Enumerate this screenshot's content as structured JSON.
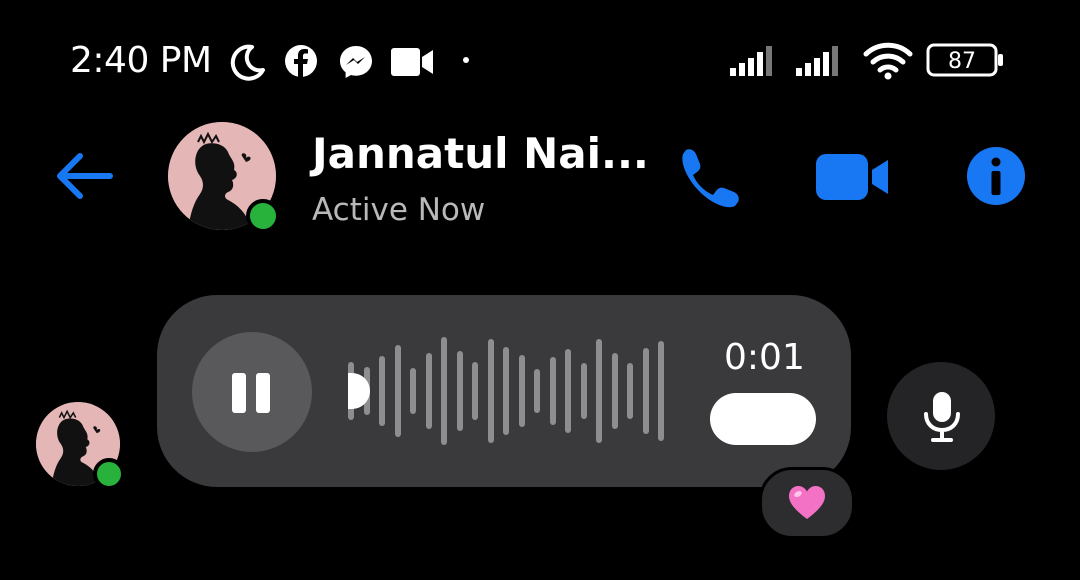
{
  "status_bar": {
    "time": "2:40 PM",
    "icons": [
      "moon-icon",
      "facebook-icon",
      "messenger-icon",
      "video-camera-icon",
      "dot-icon"
    ],
    "signal_icons": [
      "signal-1-icon",
      "signal-2-icon",
      "wifi-icon"
    ],
    "battery_level": "87"
  },
  "header": {
    "back_icon": "arrow-left-icon",
    "contact_name": "Jannatul Nai...",
    "contact_status": "Active Now",
    "actions": [
      "phone-icon",
      "video-icon",
      "info-icon"
    ]
  },
  "message": {
    "type": "voice",
    "duration": "0:01",
    "reaction": "❤️",
    "playing": true
  },
  "composer": {
    "mic_icon": "microphone-icon"
  },
  "colors": {
    "accent": "#1877f2",
    "online": "#28b23b",
    "bubble": "#3a3a3c",
    "background": "#000000"
  }
}
